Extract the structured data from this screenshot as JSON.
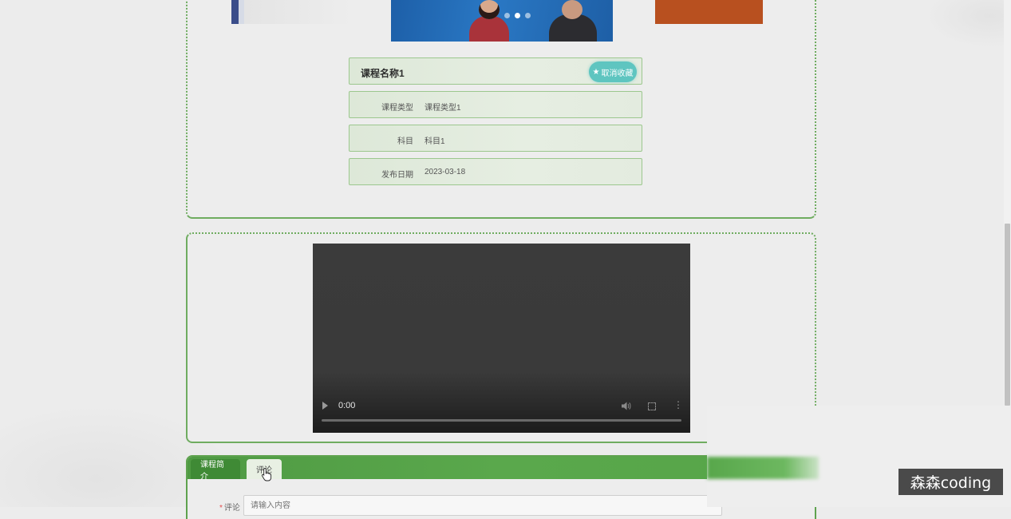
{
  "course": {
    "name": "课程名称1",
    "favorite_button": {
      "icon": "★",
      "label": "取消收藏"
    },
    "fields": [
      {
        "label": "课程类型",
        "value": "课程类型1"
      },
      {
        "label": "科目",
        "value": "科目1"
      },
      {
        "label": "发布日期",
        "value": "2023-03-18"
      }
    ]
  },
  "banner": {
    "slide_count": 3,
    "active_slide": 2
  },
  "video": {
    "time": "0:00",
    "progress": 0
  },
  "tabs": [
    {
      "label": "课程简介",
      "active": true
    },
    {
      "label": "评论",
      "active": false
    }
  ],
  "comment_form": {
    "required_mark": "*",
    "label": "评论",
    "placeholder": "请输入内容"
  },
  "watermark": "森森coding",
  "colors": {
    "accent_green": "#5aa84c",
    "favorite_button": "#5ec5c0",
    "required": "#e24d4d"
  }
}
